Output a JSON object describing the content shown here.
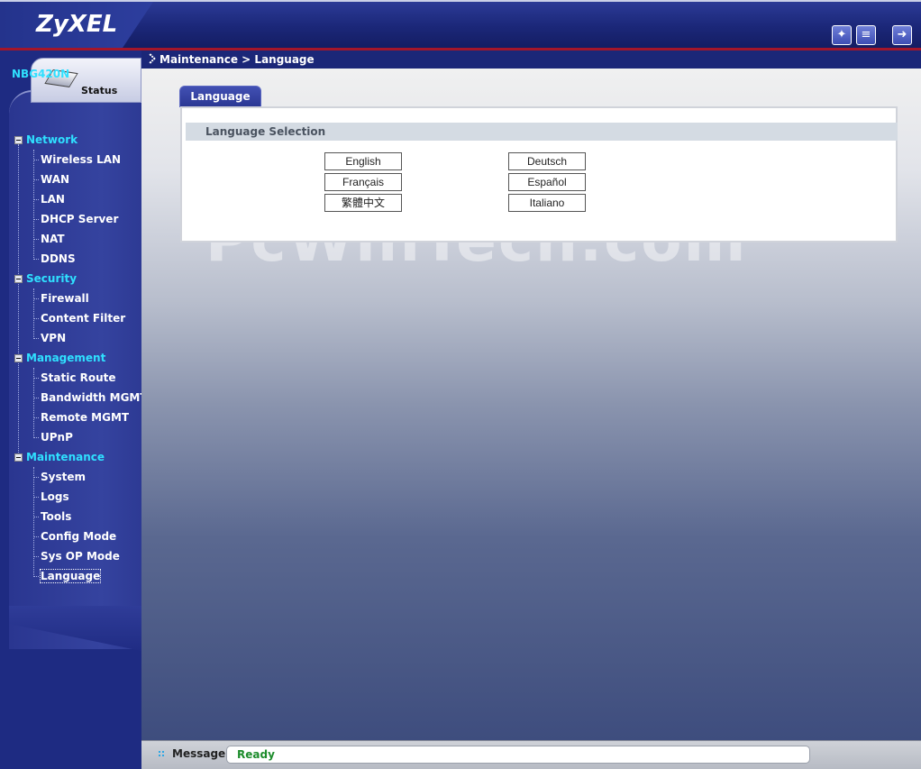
{
  "header": {
    "logo": "ZyXEL",
    "icons": [
      "wizard-icon",
      "help-icon",
      "logout-icon"
    ]
  },
  "sidebar": {
    "status_label": "Status",
    "device": "NBG420N",
    "sections": [
      {
        "label": "Network",
        "items": [
          "Wireless LAN",
          "WAN",
          "LAN",
          "DHCP Server",
          "NAT",
          "DDNS"
        ]
      },
      {
        "label": "Security",
        "items": [
          "Firewall",
          "Content Filter",
          "VPN"
        ]
      },
      {
        "label": "Management",
        "items": [
          "Static Route",
          "Bandwidth MGMT",
          "Remote MGMT",
          "UPnP"
        ]
      },
      {
        "label": "Maintenance",
        "items": [
          "System",
          "Logs",
          "Tools",
          "Config Mode",
          "Sys OP Mode",
          "Language"
        ]
      }
    ]
  },
  "breadcrumb": "Maintenance > Language",
  "main": {
    "tab": "Language",
    "section_title": "Language Selection",
    "languages": [
      "English",
      "Deutsch",
      "Français",
      "Español",
      "繁體中文",
      "Italiano"
    ]
  },
  "watermark": "PcWinTech.com",
  "message": {
    "label": "Message",
    "value": "Ready"
  },
  "colors": {
    "section_color": "#2fe0ff",
    "ready_color": "#1c8c2b",
    "accent_red": "#a4162a"
  }
}
